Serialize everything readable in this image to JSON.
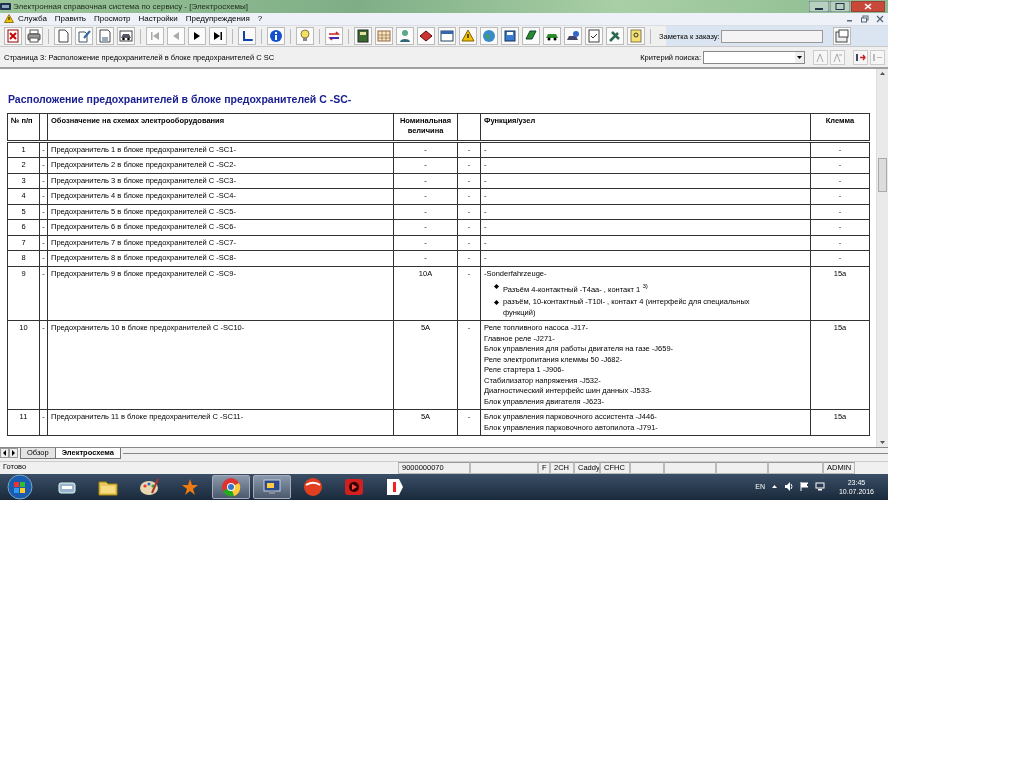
{
  "window": {
    "title": "Электронная справочная система по сервису - [Электросхемы]"
  },
  "menu": [
    "Служба",
    "Править",
    "Просмотр",
    "Настройки",
    "Предупреждения",
    "?"
  ],
  "toolbar": {
    "note_label": "Заметка к заказу:"
  },
  "page_header": {
    "title": "Страница 3: Расположение предохранителей в блоке предохранителей C SC",
    "search_label": "Критерий поиска:"
  },
  "document": {
    "heading": "Расположение предохранителей в блоке предохранителей C -SC-",
    "columns": [
      "№ п/п",
      "Обозначение на схемах электрооборудования",
      "Номинальная величина",
      "Функция/узел",
      "Клемма"
    ],
    "rows": [
      {
        "number": "1",
        "marker": "-",
        "designation": "Предохранитель 1 в блоке предохранителей C -SC1-",
        "nominal": "-",
        "nominal_marker": "-",
        "function": {
          "lines": [
            "-"
          ]
        },
        "terminal": "-"
      },
      {
        "number": "2",
        "marker": "-",
        "designation": "Предохранитель 2 в блоке предохранителей C -SC2-",
        "nominal": "-",
        "nominal_marker": "-",
        "function": {
          "lines": [
            "-"
          ]
        },
        "terminal": "-"
      },
      {
        "number": "3",
        "marker": "-",
        "designation": "Предохранитель 3 в блоке предохранителей C -SC3-",
        "nominal": "-",
        "nominal_marker": "-",
        "function": {
          "lines": [
            "-"
          ]
        },
        "terminal": "-"
      },
      {
        "number": "4",
        "marker": "-",
        "designation": "Предохранитель 4 в блоке предохранителей C -SC4-",
        "nominal": "-",
        "nominal_marker": "-",
        "function": {
          "lines": [
            "-"
          ]
        },
        "terminal": "-"
      },
      {
        "number": "5",
        "marker": "-",
        "designation": "Предохранитель 5 в блоке предохранителей C -SC5-",
        "nominal": "-",
        "nominal_marker": "-",
        "function": {
          "lines": [
            "-"
          ]
        },
        "terminal": "-"
      },
      {
        "number": "6",
        "marker": "-",
        "designation": "Предохранитель 6 в блоке предохранителей C -SC6-",
        "nominal": "-",
        "nominal_marker": "-",
        "function": {
          "lines": [
            "-"
          ]
        },
        "terminal": "-"
      },
      {
        "number": "7",
        "marker": "-",
        "designation": "Предохранитель 7 в блоке предохранителей C -SC7-",
        "nominal": "-",
        "nominal_marker": "-",
        "function": {
          "lines": [
            "-"
          ]
        },
        "terminal": "-"
      },
      {
        "number": "8",
        "marker": "-",
        "designation": "Предохранитель 8 в блоке предохранителей C -SC8-",
        "nominal": "-",
        "nominal_marker": "-",
        "function": {
          "lines": [
            "-"
          ]
        },
        "terminal": "-"
      },
      {
        "number": "9",
        "marker": "-",
        "designation": "Предохранитель 9 в блоке предохранителей C -SC9-",
        "nominal": "10A",
        "nominal_marker": "-",
        "function": {
          "lines": [
            "-Sonderfahrzeuge-"
          ],
          "bullets": [
            "Разъём 4-контактный -T4aa- , контакт 1 $^{3)}$",
            "разъём, 10-контактный -T10l- , контакт 4 (интерфейс для специальных функций)"
          ]
        },
        "terminal": "15a"
      },
      {
        "number": "10",
        "marker": "-",
        "designation": "Предохранитель 10 в блоке предохранителей C -SC10-",
        "nominal": "5A",
        "nominal_marker": "-",
        "function": {
          "lines": [
            "Реле топливного насоса -J17-",
            "Главное реле -J271-",
            "Блок управления для работы двигателя на газе -J659-",
            "Реле электропитания клеммы 50 -J682-",
            "Реле стартера 1 -J906-",
            "Стабилизатор напряжения -J532-",
            "Диагностический интерфейс шин данных -J533-",
            "Блок управления двигателя -J623-"
          ]
        },
        "terminal": "15a"
      },
      {
        "number": "11",
        "marker": "-",
        "designation": "Предохранитель 11 в блоке предохранителей C -SC11-",
        "nominal": "5A",
        "nominal_marker": "-",
        "function": {
          "lines": [
            "Блок управления парковочного ассистента -J446-",
            "Блок управления парковочного автопилота -J791-"
          ]
        },
        "terminal": "15a"
      }
    ]
  },
  "sheet_tabs": [
    {
      "label": "Обзор",
      "selected": false
    },
    {
      "label": "Электросхема",
      "selected": true
    }
  ],
  "status_bar": {
    "message": "Готово",
    "fields": [
      "9000000070",
      "F",
      "2CH",
      "Caddy",
      "CFHC",
      "ADMIN"
    ]
  },
  "taskbar": {
    "apps": [
      {
        "kind": "keyboard",
        "running": false
      },
      {
        "kind": "folder",
        "running": false
      },
      {
        "kind": "palette",
        "running": false
      },
      {
        "kind": "star",
        "running": false
      },
      {
        "kind": "browser",
        "running": true
      },
      {
        "kind": "monitor",
        "running": true
      },
      {
        "kind": "disc",
        "running": false
      },
      {
        "kind": "player",
        "running": false
      },
      {
        "kind": "tag",
        "running": false
      }
    ]
  },
  "tray": {
    "language": "EN",
    "time": "23:45",
    "date": "10.07.2016"
  }
}
